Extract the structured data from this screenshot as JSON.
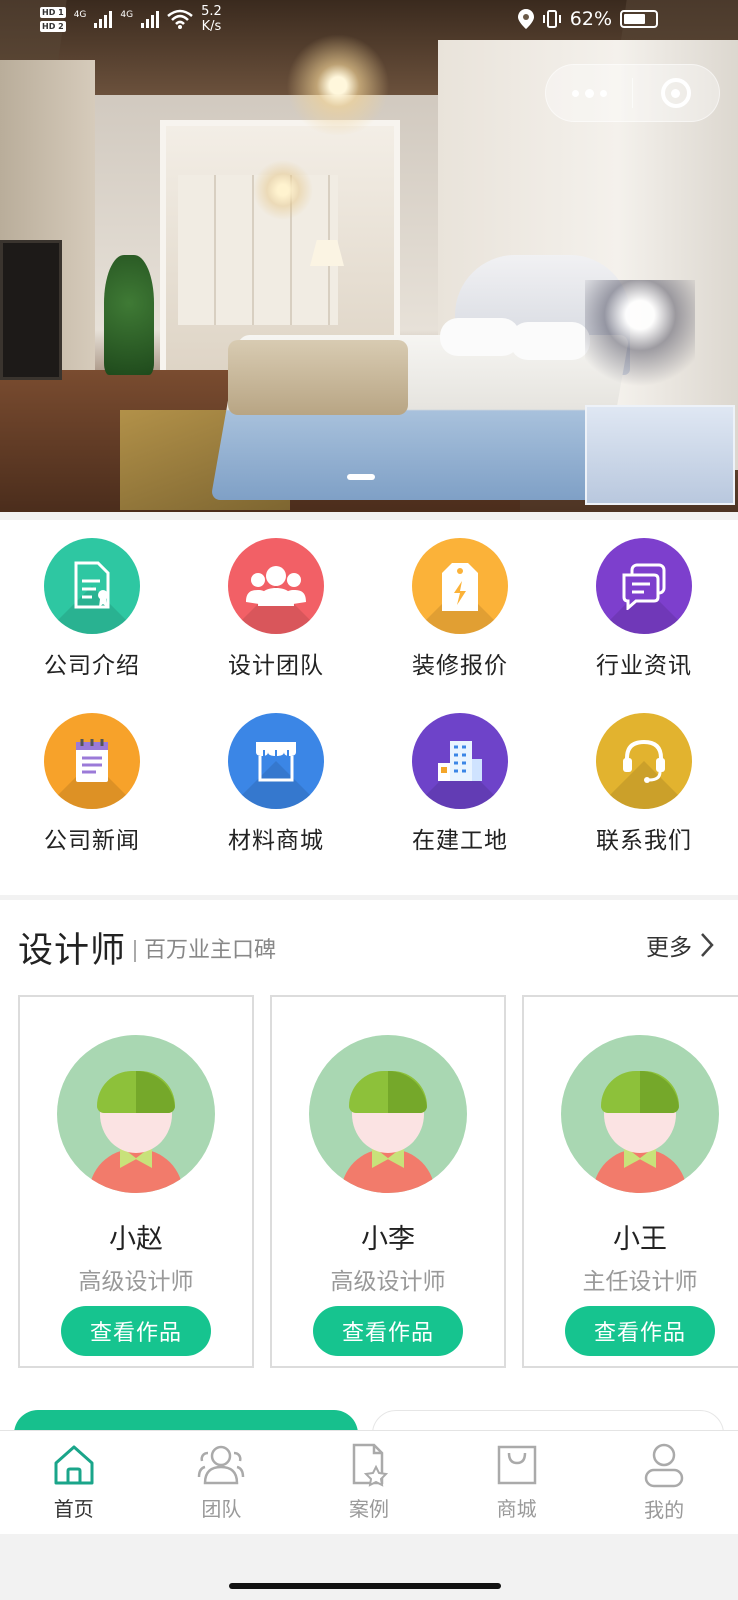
{
  "status_bar": {
    "sim_badges": [
      "HD 1",
      "HD 2"
    ],
    "network": [
      "4G",
      "4G"
    ],
    "speed_value": "5.2",
    "speed_unit": "K/s",
    "battery": "62%"
  },
  "banner": {
    "dots_total": 1,
    "dots_active": 1
  },
  "menu": {
    "items": [
      {
        "label": "公司介绍",
        "icon": "document-icon",
        "color": "#2ec7a2"
      },
      {
        "label": "设计团队",
        "icon": "team-icon",
        "color": "#f26066"
      },
      {
        "label": "装修报价",
        "icon": "price-tag-icon",
        "color": "#fbb239"
      },
      {
        "label": "行业资讯",
        "icon": "news-chat-icon",
        "color": "#7d3fcd"
      },
      {
        "label": "公司新闻",
        "icon": "notepad-icon",
        "color": "#f7a22a"
      },
      {
        "label": "材料商城",
        "icon": "store-icon",
        "color": "#3b86e6"
      },
      {
        "label": "在建工地",
        "icon": "building-icon",
        "color": "#6e43c9"
      },
      {
        "label": "联系我们",
        "icon": "headset-icon",
        "color": "#e2b32f"
      }
    ]
  },
  "designers": {
    "title": "设计师",
    "subtitle": "百万业主口碑",
    "more_label": "更多",
    "cards": [
      {
        "name": "小赵",
        "role": "高级设计师",
        "button": "查看作品"
      },
      {
        "name": "小李",
        "role": "高级设计师",
        "button": "查看作品"
      },
      {
        "name": "小王",
        "role": "主任设计师",
        "button": "查看作品"
      }
    ]
  },
  "tabbar": {
    "accent": "#1aa58a",
    "items": [
      {
        "label": "首页",
        "icon": "home-icon",
        "active": true
      },
      {
        "label": "团队",
        "icon": "team-icon",
        "active": false
      },
      {
        "label": "案例",
        "icon": "case-icon",
        "active": false
      },
      {
        "label": "商城",
        "icon": "shop-bag-icon",
        "active": false
      },
      {
        "label": "我的",
        "icon": "user-icon",
        "active": false
      }
    ]
  }
}
